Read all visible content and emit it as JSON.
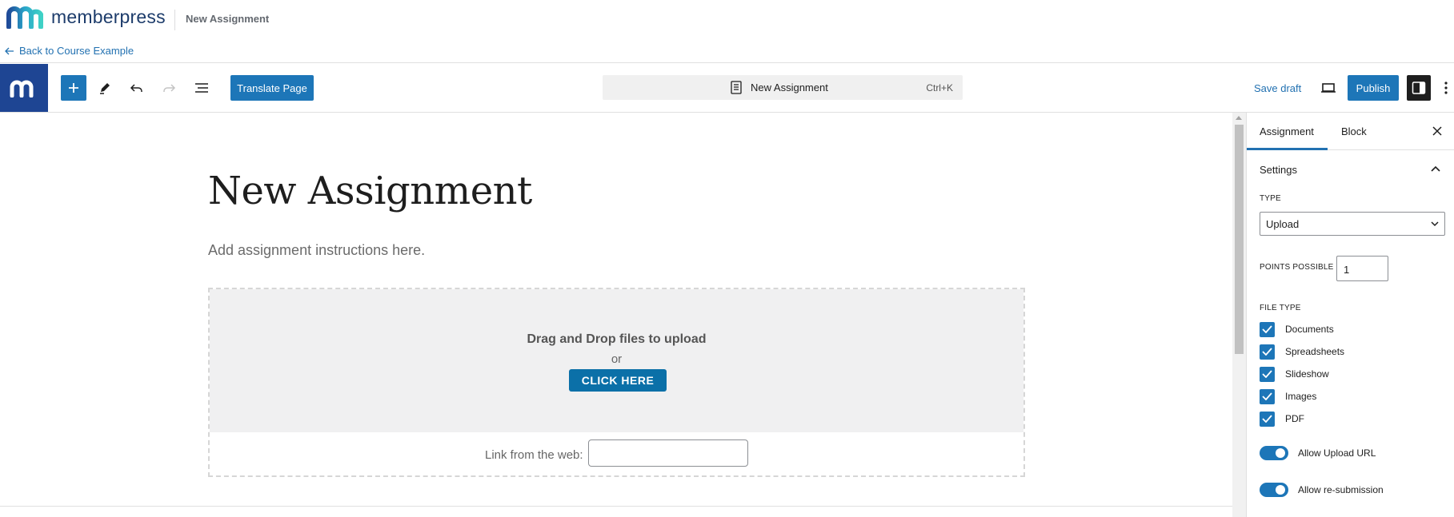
{
  "header": {
    "brand": "memberpress",
    "title": "New Assignment",
    "back_link": "Back to Course Example"
  },
  "toolbar": {
    "translate_label": "Translate Page",
    "doc_title": "New Assignment",
    "shortcut": "Ctrl+K",
    "save_draft_label": "Save draft",
    "publish_label": "Publish",
    "accent_color": "#1d76b8"
  },
  "editor": {
    "post_title": "New Assignment",
    "instructions_placeholder": "Add assignment instructions here.",
    "upload": {
      "drop_title": "Drag and Drop files to upload",
      "or_text": "or",
      "click_label": "CLICK HERE",
      "link_label": "Link from the web:",
      "link_value": ""
    }
  },
  "sidebar": {
    "tabs": [
      {
        "label": "Assignment",
        "active": true
      },
      {
        "label": "Block",
        "active": false
      }
    ],
    "section_title": "Settings",
    "type_label": "TYPE",
    "type_value": "Upload",
    "points_label": "POINTS POSSIBLE",
    "points_value": "1",
    "file_type_label": "FILE TYPE",
    "file_types": [
      {
        "label": "Documents",
        "checked": true
      },
      {
        "label": "Spreadsheets",
        "checked": true
      },
      {
        "label": "Slideshow",
        "checked": true
      },
      {
        "label": "Images",
        "checked": true
      },
      {
        "label": "PDF",
        "checked": true
      }
    ],
    "toggles": [
      {
        "label": "Allow Upload URL",
        "on": true
      },
      {
        "label": "Allow re-submission",
        "on": true
      }
    ]
  }
}
